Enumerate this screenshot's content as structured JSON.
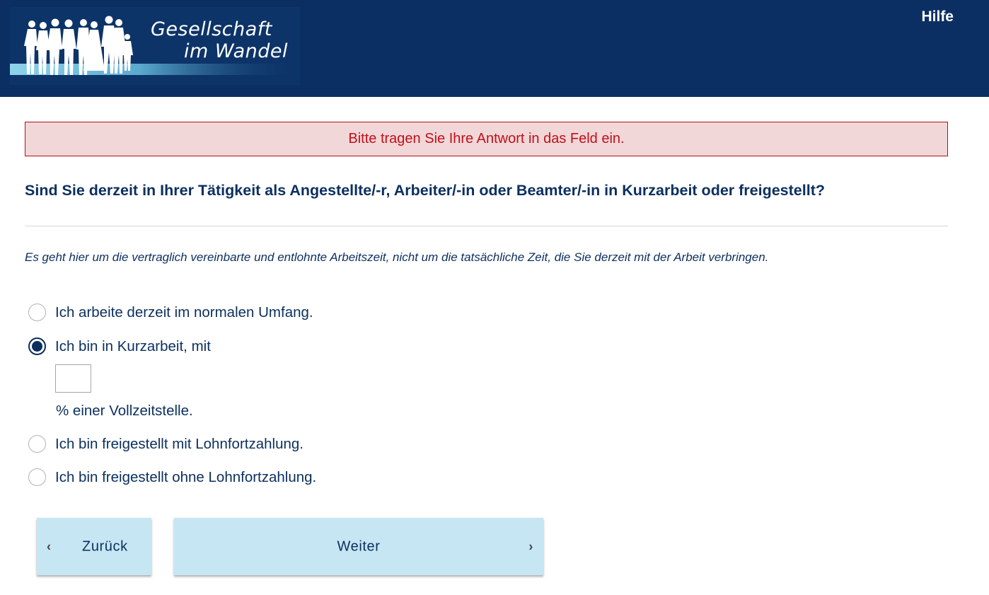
{
  "header": {
    "logo_line1": "Gesellschaft",
    "logo_line2": "im Wandel",
    "help_label": "Hilfe",
    "background_color": "#0b2f63"
  },
  "alert": {
    "message": "Bitte tragen Sie Ihre Antwort in das Feld ein.",
    "background_color": "#f2d7d8",
    "text_color": "#c0101a"
  },
  "question": {
    "title": "Sind Sie derzeit in Ihrer Tätigkeit als Angestellte/-r, Arbeiter/-in oder Beamter/-in in Kurzarbeit oder freigestellt?",
    "instruction": "Es geht hier um die vertraglich vereinbarte und entlohnte Arbeitszeit, nicht um die tatsächliche Zeit, die Sie derzeit mit der Arbeit verbringen."
  },
  "options": [
    {
      "label": "Ich arbeite derzeit im normalen Umfang.",
      "selected": false
    },
    {
      "label": "Ich bin in Kurzarbeit, mit",
      "selected": true
    },
    {
      "label": "Ich bin freigestellt mit Lohnfortzahlung.",
      "selected": false
    },
    {
      "label": "Ich bin freigestellt ohne Lohnfortzahlung.",
      "selected": false
    }
  ],
  "kurzarbeit_input": {
    "value": "",
    "suffix": "% einer Vollzeitstelle."
  },
  "navigation": {
    "back_label": "Zurück",
    "next_label": "Weiter",
    "button_color": "#c6e6f4",
    "back_icon": "chevron-left-icon",
    "next_icon": "chevron-right-icon"
  },
  "accent_color": "#0b2f5e"
}
